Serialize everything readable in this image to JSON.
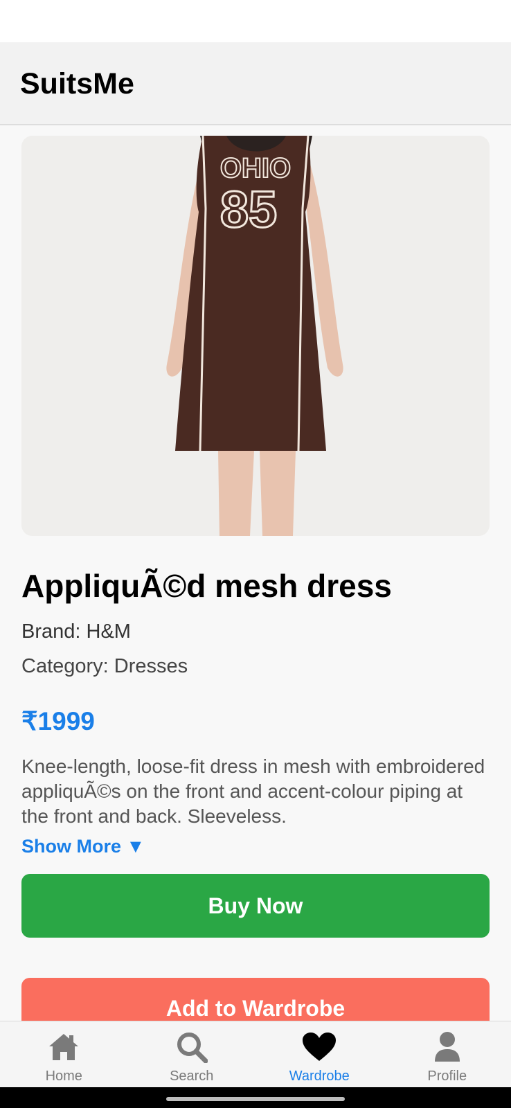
{
  "app": {
    "title": "SuitsMe"
  },
  "product": {
    "title": "AppliquÃ©d mesh dress",
    "brand": "Brand: H&M",
    "category": "Category: Dresses",
    "price": "₹1999",
    "description": "Knee-length, loose-fit dress in mesh with embroidered appliquÃ©s on the front and accent-colour piping at the front and back. Sleeveless.",
    "show_more": "Show More ▼",
    "image_text_top": "OHIO",
    "image_text_number": "85"
  },
  "actions": {
    "buy_now": "Buy Now",
    "add_to_wardrobe": "Add to Wardrobe"
  },
  "tabs": [
    {
      "label": "Home",
      "icon": "home-icon",
      "active": false
    },
    {
      "label": "Search",
      "icon": "search-icon",
      "active": false
    },
    {
      "label": "Wardrobe",
      "icon": "heart-icon",
      "active": true
    },
    {
      "label": "Profile",
      "icon": "user-icon",
      "active": false
    }
  ],
  "colors": {
    "accent": "#1a7fe8",
    "buy": "#2aa745",
    "wardrobe": "#fa6e5e",
    "icon": "#7a7a7a"
  }
}
